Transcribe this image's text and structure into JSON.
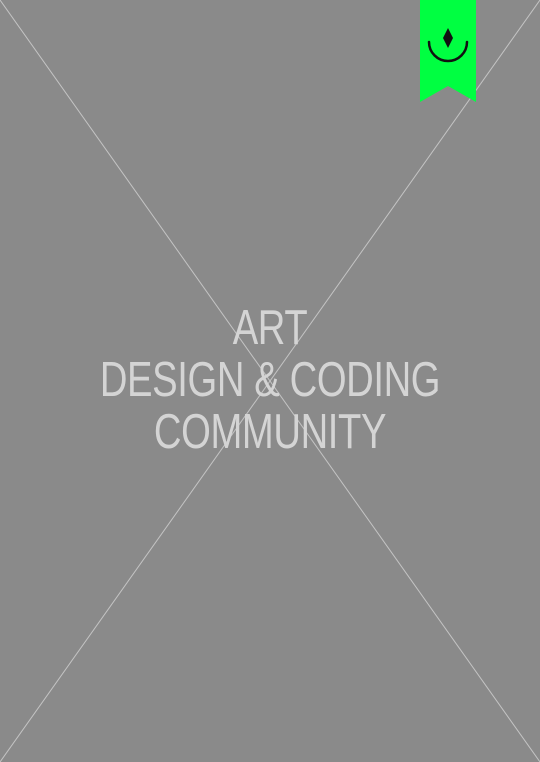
{
  "placeholder": {
    "title_lines": [
      "ART",
      "DESIGN & CODING",
      "COMMUNITY"
    ],
    "background_color": "#8a8a8a",
    "text_color": "#d4d4d4"
  },
  "badge": {
    "icon": "bookmark-smile-icon",
    "color": "#00ff41"
  }
}
